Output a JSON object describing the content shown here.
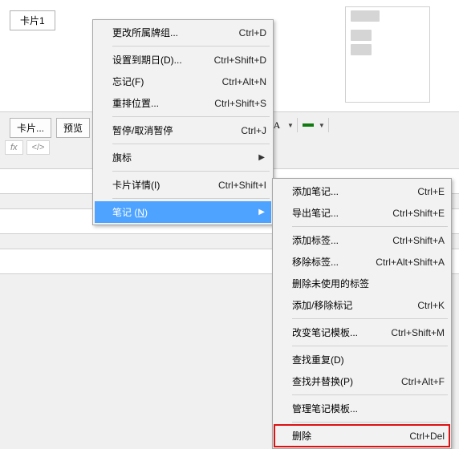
{
  "top_tab": "卡片1",
  "tabs2": {
    "cards": "卡片...",
    "preview": "预览"
  },
  "fx": {
    "fx": "fx",
    "code": "</>"
  },
  "toolbar": {
    "letter": "A"
  },
  "menu1": {
    "change_deck": {
      "label": "更改所属牌组...",
      "shortcut": "Ctrl+D"
    },
    "set_due": {
      "label": "设置到期日(D)...",
      "shortcut": "Ctrl+Shift+D"
    },
    "forget": {
      "label": "忘记(F)",
      "shortcut": "Ctrl+Alt+N"
    },
    "reposition": {
      "label": "重排位置...",
      "shortcut": "Ctrl+Shift+S"
    },
    "toggle_sus": {
      "label": "暂停/取消暂停",
      "shortcut": "Ctrl+J"
    },
    "flag": {
      "label": "旗标"
    },
    "card_info": {
      "label": "卡片详情(I)",
      "shortcut": "Ctrl+Shift+I"
    },
    "notes": {
      "label_pre": "笔记 (",
      "label_u": "N",
      "label_post": ")"
    }
  },
  "menu2": {
    "add_note": {
      "label": "添加笔记...",
      "shortcut": "Ctrl+E"
    },
    "export_note": {
      "label": "导出笔记...",
      "shortcut": "Ctrl+Shift+E"
    },
    "add_tag": {
      "label": "添加标签...",
      "shortcut": "Ctrl+Shift+A"
    },
    "remove_tag": {
      "label": "移除标签...",
      "shortcut": "Ctrl+Alt+Shift+A"
    },
    "del_unused": {
      "label": "删除未使用的标签"
    },
    "toggle_mark": {
      "label": "添加/移除标记",
      "shortcut": "Ctrl+K"
    },
    "change_tmpl": {
      "label": "改变笔记模板...",
      "shortcut": "Ctrl+Shift+M"
    },
    "find_dup": {
      "label": "查找重复(D)"
    },
    "find_replace": {
      "label": "查找并替换(P)",
      "shortcut": "Ctrl+Alt+F"
    },
    "manage_tmpl": {
      "label": "管理笔记模板..."
    },
    "delete": {
      "label": "删除",
      "shortcut": "Ctrl+Del"
    }
  }
}
